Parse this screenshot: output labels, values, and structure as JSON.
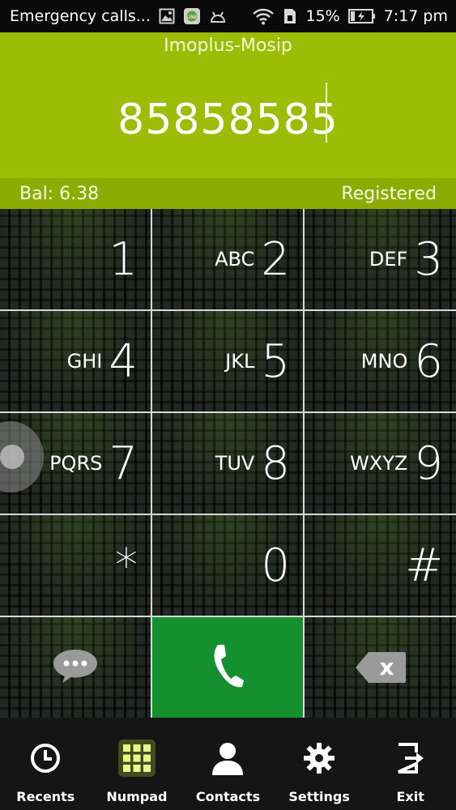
{
  "status_bar": {
    "carrier_text": "Emergency calls...",
    "battery_percent": "15%",
    "time": "7:17 pm",
    "icons": [
      "image-icon",
      "messenger-icon",
      "android-icon",
      "wifi-icon",
      "sim-icon",
      "battery-charging-icon"
    ]
  },
  "header": {
    "title": "Imoplus-Mosip",
    "dialed_number": "85858585"
  },
  "info": {
    "balance": "Bal: 6.38",
    "registration_status": "Registered"
  },
  "keypad": {
    "keys": [
      {
        "digit": "1",
        "letters": ""
      },
      {
        "digit": "2",
        "letters": "ABC"
      },
      {
        "digit": "3",
        "letters": "DEF"
      },
      {
        "digit": "4",
        "letters": "GHI"
      },
      {
        "digit": "5",
        "letters": "JKL"
      },
      {
        "digit": "6",
        "letters": "MNO"
      },
      {
        "digit": "7",
        "letters": "PQRS"
      },
      {
        "digit": "8",
        "letters": "TUV"
      },
      {
        "digit": "9",
        "letters": "WXYZ"
      },
      {
        "digit": "*",
        "letters": ""
      },
      {
        "digit": "0",
        "letters": ""
      },
      {
        "digit": "#",
        "letters": ""
      }
    ],
    "action_icons": [
      "message-icon",
      "phone-call-icon",
      "backspace-icon"
    ],
    "delete_glyph": "x"
  },
  "nav": {
    "items": [
      {
        "label": "Recents",
        "icon": "clock-icon"
      },
      {
        "label": "Numpad",
        "icon": "grid-icon"
      },
      {
        "label": "Contacts",
        "icon": "person-icon"
      },
      {
        "label": "Settings",
        "icon": "gear-icon"
      },
      {
        "label": "Exit",
        "icon": "exit-icon"
      }
    ],
    "active": "Numpad"
  },
  "colors": {
    "header_green": "#9cbc05",
    "call_green": "#14902f",
    "nav_active_glow": "#d8ef4a"
  }
}
